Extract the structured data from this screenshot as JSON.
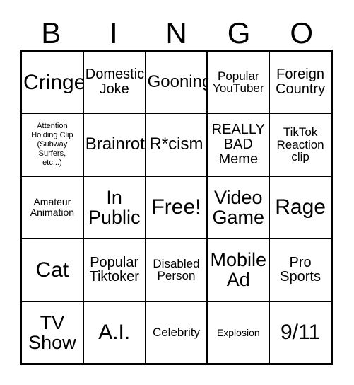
{
  "card": {
    "title": "BINGO",
    "header_letters": [
      "B",
      "I",
      "N",
      "G",
      "O"
    ],
    "free_space_label": "Free!",
    "accent_color": "#000000",
    "background_color": "#ffffff",
    "rows": 5,
    "columns": 5,
    "cells": [
      [
        {
          "text": "Cringe",
          "size": "fs-xxl"
        },
        {
          "text": "Domestic\nJoke",
          "size": "fs-md"
        },
        {
          "text": "Gooning",
          "size": "fs-lg"
        },
        {
          "text": "Popular\nYouTuber",
          "size": "fs-sm"
        },
        {
          "text": "Foreign\nCountry",
          "size": "fs-md"
        }
      ],
      [
        {
          "text": "Attention\nHolding Clip\n(Subway\nSurfers,\netc...)",
          "size": "fs-xxs"
        },
        {
          "text": "Brainrot",
          "size": "fs-lg"
        },
        {
          "text": "R*cism",
          "size": "fs-lg"
        },
        {
          "text": "REALLY\nBAD\nMeme",
          "size": "fs-md"
        },
        {
          "text": "TikTok\nReaction\nclip",
          "size": "fs-sm"
        }
      ],
      [
        {
          "text": "Amateur\nAnimation",
          "size": "fs-xs"
        },
        {
          "text": "In\nPublic",
          "size": "fs-xl"
        },
        {
          "text": "Free!",
          "size": "fs-xxl"
        },
        {
          "text": "Video\nGame",
          "size": "fs-xl"
        },
        {
          "text": "Rage",
          "size": "fs-xxl"
        }
      ],
      [
        {
          "text": "Cat",
          "size": "fs-xxl"
        },
        {
          "text": "Popular\nTiktoker",
          "size": "fs-md"
        },
        {
          "text": "Disabled\nPerson",
          "size": "fs-sm"
        },
        {
          "text": "Mobile\nAd",
          "size": "fs-xl"
        },
        {
          "text": "Pro\nSports",
          "size": "fs-md"
        }
      ],
      [
        {
          "text": "TV\nShow",
          "size": "fs-xl"
        },
        {
          "text": "A.I.",
          "size": "fs-xxl"
        },
        {
          "text": "Celebrity",
          "size": "fs-sm"
        },
        {
          "text": "Explosion",
          "size": "fs-xs"
        },
        {
          "text": "9/11",
          "size": "fs-xxl"
        }
      ]
    ]
  }
}
